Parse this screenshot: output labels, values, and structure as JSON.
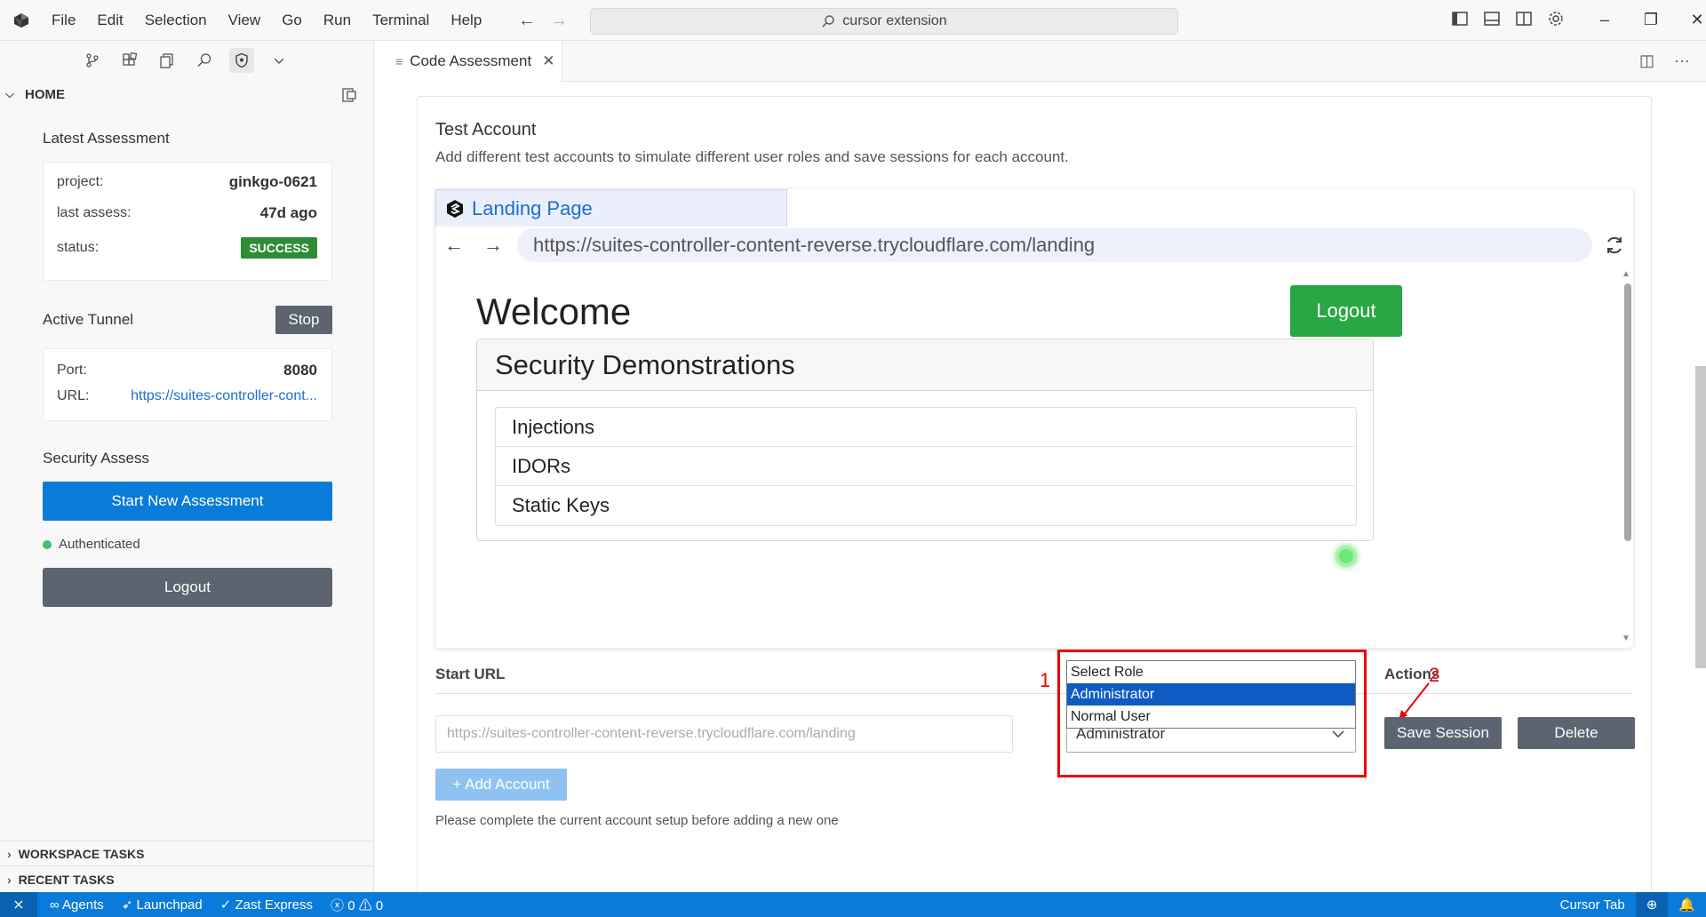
{
  "window": {
    "menu": [
      "File",
      "Edit",
      "Selection",
      "View",
      "Go",
      "Run",
      "Terminal",
      "Help"
    ],
    "search_text": "cursor extension"
  },
  "sidebar": {
    "home_label": "HOME",
    "latest_assessment": {
      "title": "Latest Assessment",
      "project_label": "project:",
      "project_value": "ginkgo-0621",
      "last_assess_label": "last assess:",
      "last_assess_value": "47d ago",
      "status_label": "status:",
      "status_value": "SUCCESS"
    },
    "active_tunnel": {
      "title": "Active Tunnel",
      "stop_label": "Stop",
      "port_label": "Port:",
      "port_value": "8080",
      "url_label": "URL:",
      "url_value": "https://suites-controller-cont..."
    },
    "security_assess": {
      "title": "Security Assess",
      "start_button": "Start New Assessment",
      "auth_status": "Authenticated",
      "logout_button": "Logout"
    },
    "workspace_tasks": "WORKSPACE TASKS",
    "recent_tasks": "RECENT TASKS"
  },
  "editor": {
    "tab_label": "Code Assessment",
    "test_account": {
      "title": "Test Account",
      "description": "Add different test accounts to simulate different user roles and save sessions for each account."
    },
    "browser": {
      "tab_title": "Landing Page",
      "url": "https://suites-controller-content-reverse.trycloudflare.com/landing",
      "welcome": "Welcome",
      "logout_label": "Logout",
      "section_title": "Security Demonstrations",
      "items": [
        "Injections",
        "IDORs",
        "Static Keys"
      ]
    },
    "form": {
      "start_url_label": "Start URL",
      "actions_label": "Actions",
      "url_placeholder": "https://suites-controller-content-reverse.trycloudflare.com/landing",
      "role_value": "Administrator",
      "role_options": [
        "Select Role",
        "Administrator",
        "Normal User"
      ],
      "save_label": "Save Session",
      "delete_label": "Delete",
      "add_label": "+ Add Account",
      "hint": "Please complete the current account setup before adding a new one"
    },
    "annotations": [
      "1",
      "2"
    ]
  },
  "statusbar": {
    "agents": "Agents",
    "launchpad": "Launchpad",
    "zast": "Zast Express",
    "problems": "0",
    "warnings": "0",
    "cursor_tab": "Cursor Tab"
  },
  "colors": {
    "accent": "#0a7bd9",
    "success": "#2e8b36",
    "logout_green": "#28a745",
    "annotation_red": "#e00000",
    "secondary_button": "#5b6470"
  }
}
